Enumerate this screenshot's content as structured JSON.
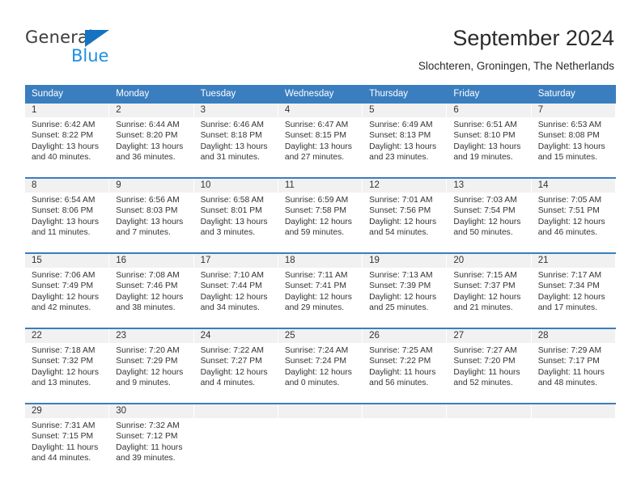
{
  "brand": {
    "name_part1": "General",
    "name_part2": "Blue",
    "triangle_color": "#1673c0",
    "blue_text_color": "#1e8fe0"
  },
  "header": {
    "title": "September 2024",
    "subtitle": "Slochteren, Groningen, The Netherlands"
  },
  "theme": {
    "header_blue": "#3a7ebf",
    "day_number_bg": "#f1f1f1",
    "text_color": "#333333"
  },
  "weekdays": [
    "Sunday",
    "Monday",
    "Tuesday",
    "Wednesday",
    "Thursday",
    "Friday",
    "Saturday"
  ],
  "weeks": [
    [
      {
        "day": "1",
        "sunrise": "Sunrise: 6:42 AM",
        "sunset": "Sunset: 8:22 PM",
        "daylight_line1": "Daylight: 13 hours",
        "daylight_line2": "and 40 minutes."
      },
      {
        "day": "2",
        "sunrise": "Sunrise: 6:44 AM",
        "sunset": "Sunset: 8:20 PM",
        "daylight_line1": "Daylight: 13 hours",
        "daylight_line2": "and 36 minutes."
      },
      {
        "day": "3",
        "sunrise": "Sunrise: 6:46 AM",
        "sunset": "Sunset: 8:18 PM",
        "daylight_line1": "Daylight: 13 hours",
        "daylight_line2": "and 31 minutes."
      },
      {
        "day": "4",
        "sunrise": "Sunrise: 6:47 AM",
        "sunset": "Sunset: 8:15 PM",
        "daylight_line1": "Daylight: 13 hours",
        "daylight_line2": "and 27 minutes."
      },
      {
        "day": "5",
        "sunrise": "Sunrise: 6:49 AM",
        "sunset": "Sunset: 8:13 PM",
        "daylight_line1": "Daylight: 13 hours",
        "daylight_line2": "and 23 minutes."
      },
      {
        "day": "6",
        "sunrise": "Sunrise: 6:51 AM",
        "sunset": "Sunset: 8:10 PM",
        "daylight_line1": "Daylight: 13 hours",
        "daylight_line2": "and 19 minutes."
      },
      {
        "day": "7",
        "sunrise": "Sunrise: 6:53 AM",
        "sunset": "Sunset: 8:08 PM",
        "daylight_line1": "Daylight: 13 hours",
        "daylight_line2": "and 15 minutes."
      }
    ],
    [
      {
        "day": "8",
        "sunrise": "Sunrise: 6:54 AM",
        "sunset": "Sunset: 8:06 PM",
        "daylight_line1": "Daylight: 13 hours",
        "daylight_line2": "and 11 minutes."
      },
      {
        "day": "9",
        "sunrise": "Sunrise: 6:56 AM",
        "sunset": "Sunset: 8:03 PM",
        "daylight_line1": "Daylight: 13 hours",
        "daylight_line2": "and 7 minutes."
      },
      {
        "day": "10",
        "sunrise": "Sunrise: 6:58 AM",
        "sunset": "Sunset: 8:01 PM",
        "daylight_line1": "Daylight: 13 hours",
        "daylight_line2": "and 3 minutes."
      },
      {
        "day": "11",
        "sunrise": "Sunrise: 6:59 AM",
        "sunset": "Sunset: 7:58 PM",
        "daylight_line1": "Daylight: 12 hours",
        "daylight_line2": "and 59 minutes."
      },
      {
        "day": "12",
        "sunrise": "Sunrise: 7:01 AM",
        "sunset": "Sunset: 7:56 PM",
        "daylight_line1": "Daylight: 12 hours",
        "daylight_line2": "and 54 minutes."
      },
      {
        "day": "13",
        "sunrise": "Sunrise: 7:03 AM",
        "sunset": "Sunset: 7:54 PM",
        "daylight_line1": "Daylight: 12 hours",
        "daylight_line2": "and 50 minutes."
      },
      {
        "day": "14",
        "sunrise": "Sunrise: 7:05 AM",
        "sunset": "Sunset: 7:51 PM",
        "daylight_line1": "Daylight: 12 hours",
        "daylight_line2": "and 46 minutes."
      }
    ],
    [
      {
        "day": "15",
        "sunrise": "Sunrise: 7:06 AM",
        "sunset": "Sunset: 7:49 PM",
        "daylight_line1": "Daylight: 12 hours",
        "daylight_line2": "and 42 minutes."
      },
      {
        "day": "16",
        "sunrise": "Sunrise: 7:08 AM",
        "sunset": "Sunset: 7:46 PM",
        "daylight_line1": "Daylight: 12 hours",
        "daylight_line2": "and 38 minutes."
      },
      {
        "day": "17",
        "sunrise": "Sunrise: 7:10 AM",
        "sunset": "Sunset: 7:44 PM",
        "daylight_line1": "Daylight: 12 hours",
        "daylight_line2": "and 34 minutes."
      },
      {
        "day": "18",
        "sunrise": "Sunrise: 7:11 AM",
        "sunset": "Sunset: 7:41 PM",
        "daylight_line1": "Daylight: 12 hours",
        "daylight_line2": "and 29 minutes."
      },
      {
        "day": "19",
        "sunrise": "Sunrise: 7:13 AM",
        "sunset": "Sunset: 7:39 PM",
        "daylight_line1": "Daylight: 12 hours",
        "daylight_line2": "and 25 minutes."
      },
      {
        "day": "20",
        "sunrise": "Sunrise: 7:15 AM",
        "sunset": "Sunset: 7:37 PM",
        "daylight_line1": "Daylight: 12 hours",
        "daylight_line2": "and 21 minutes."
      },
      {
        "day": "21",
        "sunrise": "Sunrise: 7:17 AM",
        "sunset": "Sunset: 7:34 PM",
        "daylight_line1": "Daylight: 12 hours",
        "daylight_line2": "and 17 minutes."
      }
    ],
    [
      {
        "day": "22",
        "sunrise": "Sunrise: 7:18 AM",
        "sunset": "Sunset: 7:32 PM",
        "daylight_line1": "Daylight: 12 hours",
        "daylight_line2": "and 13 minutes."
      },
      {
        "day": "23",
        "sunrise": "Sunrise: 7:20 AM",
        "sunset": "Sunset: 7:29 PM",
        "daylight_line1": "Daylight: 12 hours",
        "daylight_line2": "and 9 minutes."
      },
      {
        "day": "24",
        "sunrise": "Sunrise: 7:22 AM",
        "sunset": "Sunset: 7:27 PM",
        "daylight_line1": "Daylight: 12 hours",
        "daylight_line2": "and 4 minutes."
      },
      {
        "day": "25",
        "sunrise": "Sunrise: 7:24 AM",
        "sunset": "Sunset: 7:24 PM",
        "daylight_line1": "Daylight: 12 hours",
        "daylight_line2": "and 0 minutes."
      },
      {
        "day": "26",
        "sunrise": "Sunrise: 7:25 AM",
        "sunset": "Sunset: 7:22 PM",
        "daylight_line1": "Daylight: 11 hours",
        "daylight_line2": "and 56 minutes."
      },
      {
        "day": "27",
        "sunrise": "Sunrise: 7:27 AM",
        "sunset": "Sunset: 7:20 PM",
        "daylight_line1": "Daylight: 11 hours",
        "daylight_line2": "and 52 minutes."
      },
      {
        "day": "28",
        "sunrise": "Sunrise: 7:29 AM",
        "sunset": "Sunset: 7:17 PM",
        "daylight_line1": "Daylight: 11 hours",
        "daylight_line2": "and 48 minutes."
      }
    ],
    [
      {
        "day": "29",
        "sunrise": "Sunrise: 7:31 AM",
        "sunset": "Sunset: 7:15 PM",
        "daylight_line1": "Daylight: 11 hours",
        "daylight_line2": "and 44 minutes."
      },
      {
        "day": "30",
        "sunrise": "Sunrise: 7:32 AM",
        "sunset": "Sunset: 7:12 PM",
        "daylight_line1": "Daylight: 11 hours",
        "daylight_line2": "and 39 minutes."
      },
      {
        "day": "",
        "sunrise": "",
        "sunset": "",
        "daylight_line1": "",
        "daylight_line2": ""
      },
      {
        "day": "",
        "sunrise": "",
        "sunset": "",
        "daylight_line1": "",
        "daylight_line2": ""
      },
      {
        "day": "",
        "sunrise": "",
        "sunset": "",
        "daylight_line1": "",
        "daylight_line2": ""
      },
      {
        "day": "",
        "sunrise": "",
        "sunset": "",
        "daylight_line1": "",
        "daylight_line2": ""
      },
      {
        "day": "",
        "sunrise": "",
        "sunset": "",
        "daylight_line1": "",
        "daylight_line2": ""
      }
    ]
  ]
}
